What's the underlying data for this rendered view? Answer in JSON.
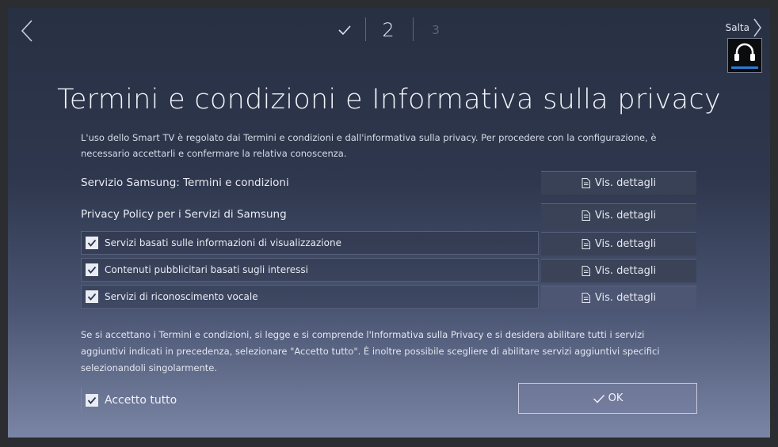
{
  "header": {
    "step_current": "2",
    "step_next": "3",
    "skip_label": "Salta"
  },
  "title": "Termini e condizioni e Informativa sulla privacy",
  "intro": "L'uso dello Smart TV è regolato dai Termini e condizioni e dall'informativa sulla privacy. Per procedere con la configurazione, è necessario accettarli e confermare la relativa conoscenza.",
  "agreements": [
    {
      "label": "Servizio Samsung: Termini e condizioni",
      "button": "Vis. dettagli"
    },
    {
      "label": "Privacy Policy per i Servizi di Samsung",
      "button": "Vis. dettagli"
    },
    {
      "label": "Servizi basati sulle informazioni di visualizzazione",
      "button": "Vis. dettagli",
      "checked": true
    },
    {
      "label": "Contenuti pubblicitari basati sugli interessi",
      "button": "Vis. dettagli",
      "checked": true
    },
    {
      "label": "Servizi di riconoscimento vocale",
      "button": "Vis. dettagli",
      "checked": true
    }
  ],
  "bottom_text": "Se si accettano i Termini e condizioni, si legge e si comprende l'Informativa sulla Privacy e si desidera abilitare tutti i servizi aggiuntivi indicati in precedenza, selezionare \"Accetto tutto\". È inoltre possibile scegliere di abilitare servizi aggiuntivi specifici selezionandoli singolarmente.",
  "accept_all": {
    "label": "Accetto tutto",
    "checked": true
  },
  "ok_label": "OK",
  "colors": {
    "accent_blue": "#2a7bd6",
    "background_top": "#283043",
    "background_bottom": "#7a84a4"
  },
  "icons": [
    "back-arrow-icon",
    "check-icon",
    "next-arrow-icon",
    "headset-icon",
    "document-icon",
    "checkbox-checked-icon"
  ]
}
